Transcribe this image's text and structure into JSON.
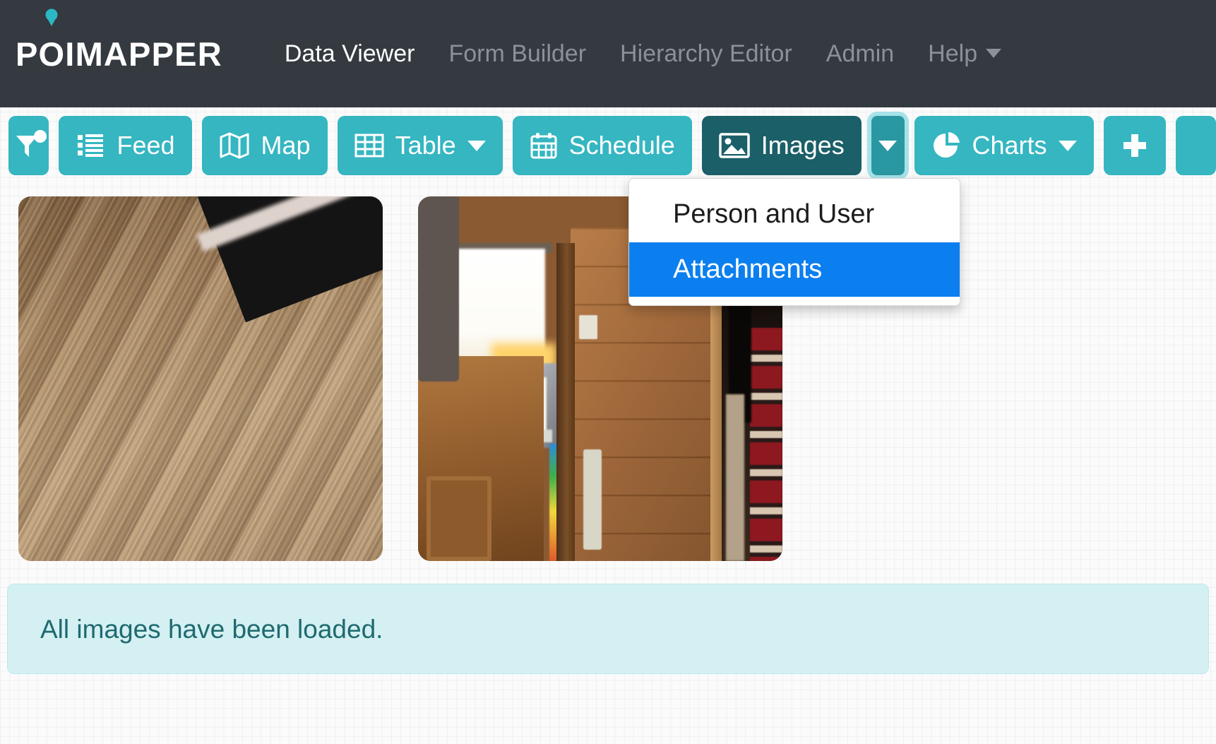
{
  "navbar": {
    "brand": "POIMAPPER",
    "brand_pin_icon": "map-pin-icon",
    "accent_color": "#35b6c1",
    "background_color": "#343a40",
    "links": [
      {
        "label": "Data Viewer",
        "active": true
      },
      {
        "label": "Form Builder",
        "active": false
      },
      {
        "label": "Hierarchy Editor",
        "active": false
      },
      {
        "label": "Admin",
        "active": false
      },
      {
        "label": "Help",
        "active": false,
        "has_caret": true
      }
    ]
  },
  "toolbar": {
    "filter": {
      "label": "",
      "icon": "filter-funnel-icon",
      "badge": "dot-badge"
    },
    "buttons": [
      {
        "label": "Feed",
        "icon": "list-icon",
        "caret": false,
        "active": false
      },
      {
        "label": "Map",
        "icon": "map-folded-icon",
        "caret": false,
        "active": false
      },
      {
        "label": "Table",
        "icon": "table-grid-icon",
        "caret": true,
        "active": false
      },
      {
        "label": "Schedule",
        "icon": "calendar-icon",
        "caret": false,
        "active": false
      },
      {
        "label": "Images",
        "icon": "image-picture-icon",
        "caret": false,
        "active": true
      }
    ],
    "split_toggle": {
      "icon": "caret-down-icon",
      "expanded": true
    },
    "charts": {
      "label": "Charts",
      "icon": "pie-chart-icon",
      "caret": true
    },
    "add": {
      "label": "+",
      "icon": "plus-icon"
    }
  },
  "dropdown": {
    "items": [
      {
        "label": "Person and User",
        "highlighted": false
      },
      {
        "label": "Attachments",
        "highlighted": true
      }
    ],
    "highlight_color": "#0b7fef"
  },
  "gallery": {
    "images": [
      {
        "alt": "wood grain table surface photo"
      },
      {
        "alt": "wooden cabin interior with kitchen and red striped rug"
      }
    ]
  },
  "alert": {
    "message": "All images have been loaded.",
    "background_color": "#d4f0f2",
    "text_color": "#1f6a70"
  }
}
